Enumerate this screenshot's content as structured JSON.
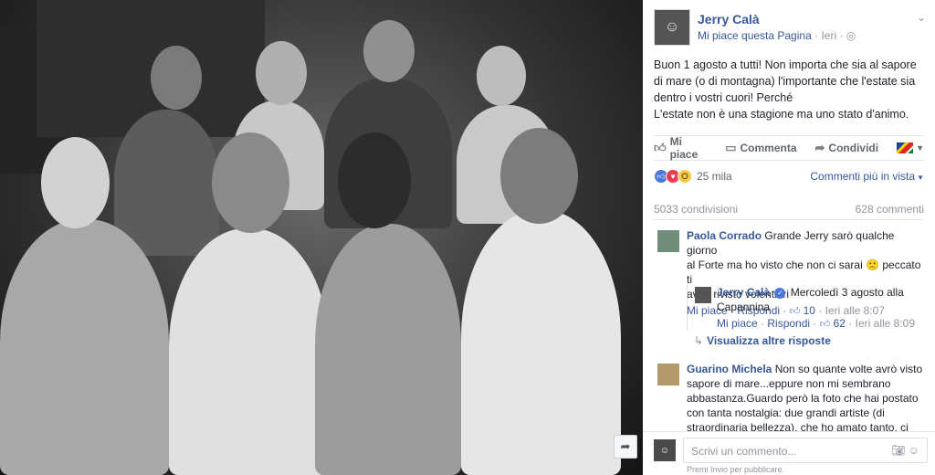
{
  "photo": {
    "alt": "",
    "share_icon": "share-arrow-icon"
  },
  "post": {
    "author": "Jerry Calà",
    "like_page": "Mi piace questa Pagina",
    "time": "Ieri",
    "audience_icon": "globe-icon",
    "menu_icon": "chevron-down-icon",
    "text_lines": [
      "Buon 1 agosto a tutti! Non importa che sia al sapore",
      "di mare (o di montagna) l'importante che l'estate sia",
      "dentro i vostri cuori! Perché",
      "L'estate non è una stagione ma uno stato d'animo."
    ]
  },
  "actions": {
    "like": "Mi piace",
    "comment": "Commenta",
    "share": "Condividi",
    "like_icon": "thumbs-up-icon",
    "comment_icon": "speech-bubble-icon",
    "share_icon": "share-arrow-icon",
    "language_icon": "flag-icon"
  },
  "reactions": {
    "count": "25 mila",
    "sort_label": "Commenti più in vista",
    "types": [
      "like",
      "love",
      "wow"
    ]
  },
  "stats": {
    "shares": "5033 condivisioni",
    "comments": "628 commenti"
  },
  "comments": [
    {
      "name": "Paola Corrado",
      "text_lines": [
        "Grande Jerry sarò qualche giorno",
        "al Forte ma ho visto che non ci sarai 🙁 peccato ti",
        "avrei rivisto volentieri"
      ],
      "like": "Mi piace",
      "reply": "Rispondi",
      "likes": "10",
      "time": "Ieri alle 8:07"
    },
    {
      "name": "Guarino Michela",
      "text_lines": [
        "Non so quante volte avrò visto",
        "sapore di mare...eppure non mi sembrano",
        "abbastanza.Guardo però la foto che hai postato",
        "con tanta nostalgia: due grandi artiste (di",
        "straordinaria bellezza), che ho amato tanto, ci hanno"
      ]
    }
  ],
  "reply": {
    "name": "Jerry Calà",
    "text_lines": [
      "Mercoledì 3 agosto alla",
      "Capannina"
    ],
    "like": "Mi piace",
    "reply": "Rispondi",
    "likes": "62",
    "time": "Ieri alle 8:09"
  },
  "more_replies": "Visualizza altre risposte",
  "composer": {
    "placeholder": "Scrivi un commento...",
    "hint": "Premi Invio per pubblicare.",
    "camera_icon": "camera-icon",
    "emoji_icon": "emoji-icon"
  }
}
